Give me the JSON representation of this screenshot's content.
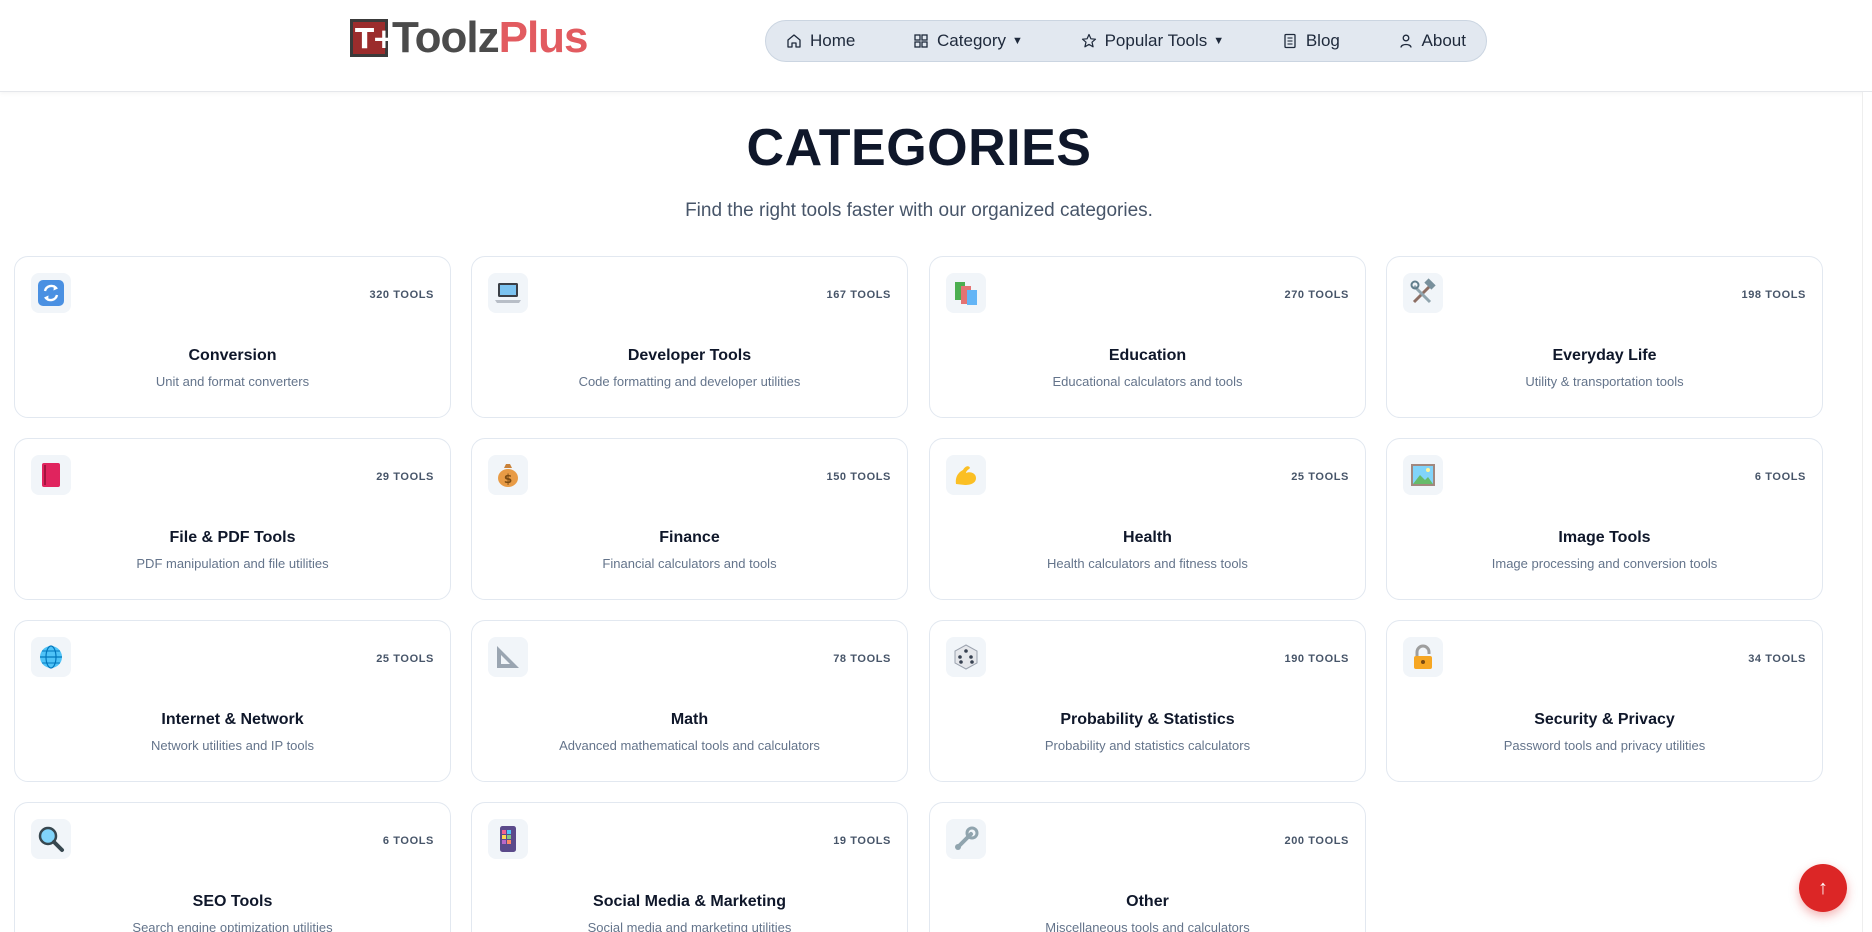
{
  "logo": {
    "mark": "T+",
    "text_a": "Toolz",
    "text_b": "Plus"
  },
  "nav": {
    "home": "Home",
    "category": "Category",
    "popular": "Popular Tools",
    "blog": "Blog",
    "about": "About"
  },
  "hero": {
    "title": "CATEGORIES",
    "subtitle": "Find the right tools faster with our organized categories."
  },
  "categories": [
    {
      "name": "Conversion",
      "desc": "Unit and format converters",
      "count": "320 TOOLS",
      "icon": "refresh-icon"
    },
    {
      "name": "Developer Tools",
      "desc": "Code formatting and developer utilities",
      "count": "167 TOOLS",
      "icon": "laptop-icon"
    },
    {
      "name": "Education",
      "desc": "Educational calculators and tools",
      "count": "270 TOOLS",
      "icon": "books-icon"
    },
    {
      "name": "Everyday Life",
      "desc": "Utility & transportation tools",
      "count": "198 TOOLS",
      "icon": "tools-icon"
    },
    {
      "name": "File & PDF Tools",
      "desc": "PDF manipulation and file utilities",
      "count": "29 TOOLS",
      "icon": "book-icon"
    },
    {
      "name": "Finance",
      "desc": "Financial calculators and tools",
      "count": "150 TOOLS",
      "icon": "money-bag-icon"
    },
    {
      "name": "Health",
      "desc": "Health calculators and fitness tools",
      "count": "25 TOOLS",
      "icon": "muscle-icon"
    },
    {
      "name": "Image Tools",
      "desc": "Image processing and conversion tools",
      "count": "6 TOOLS",
      "icon": "picture-icon"
    },
    {
      "name": "Internet & Network",
      "desc": "Network utilities and IP tools",
      "count": "25 TOOLS",
      "icon": "globe-icon"
    },
    {
      "name": "Math",
      "desc": "Advanced mathematical tools and calculators",
      "count": "78 TOOLS",
      "icon": "triangle-ruler-icon"
    },
    {
      "name": "Probability & Statistics",
      "desc": "Probability and statistics calculators",
      "count": "190 TOOLS",
      "icon": "dice-icon"
    },
    {
      "name": "Security & Privacy",
      "desc": "Password tools and privacy utilities",
      "count": "34 TOOLS",
      "icon": "lock-icon"
    },
    {
      "name": "SEO Tools",
      "desc": "Search engine optimization utilities",
      "count": "6 TOOLS",
      "icon": "magnifier-icon"
    },
    {
      "name": "Social Media & Marketing",
      "desc": "Social media and marketing utilities",
      "count": "19 TOOLS",
      "icon": "phone-icon"
    },
    {
      "name": "Other",
      "desc": "Miscellaneous tools and calculators",
      "count": "200 TOOLS",
      "icon": "wrench-icon"
    }
  ],
  "fab": {
    "icon": "arrow-up-icon",
    "glyph": "↑"
  },
  "colors": {
    "accent": "#dc2626",
    "logo_red": "#e25b60",
    "nav_bg": "#e2e8f0"
  }
}
